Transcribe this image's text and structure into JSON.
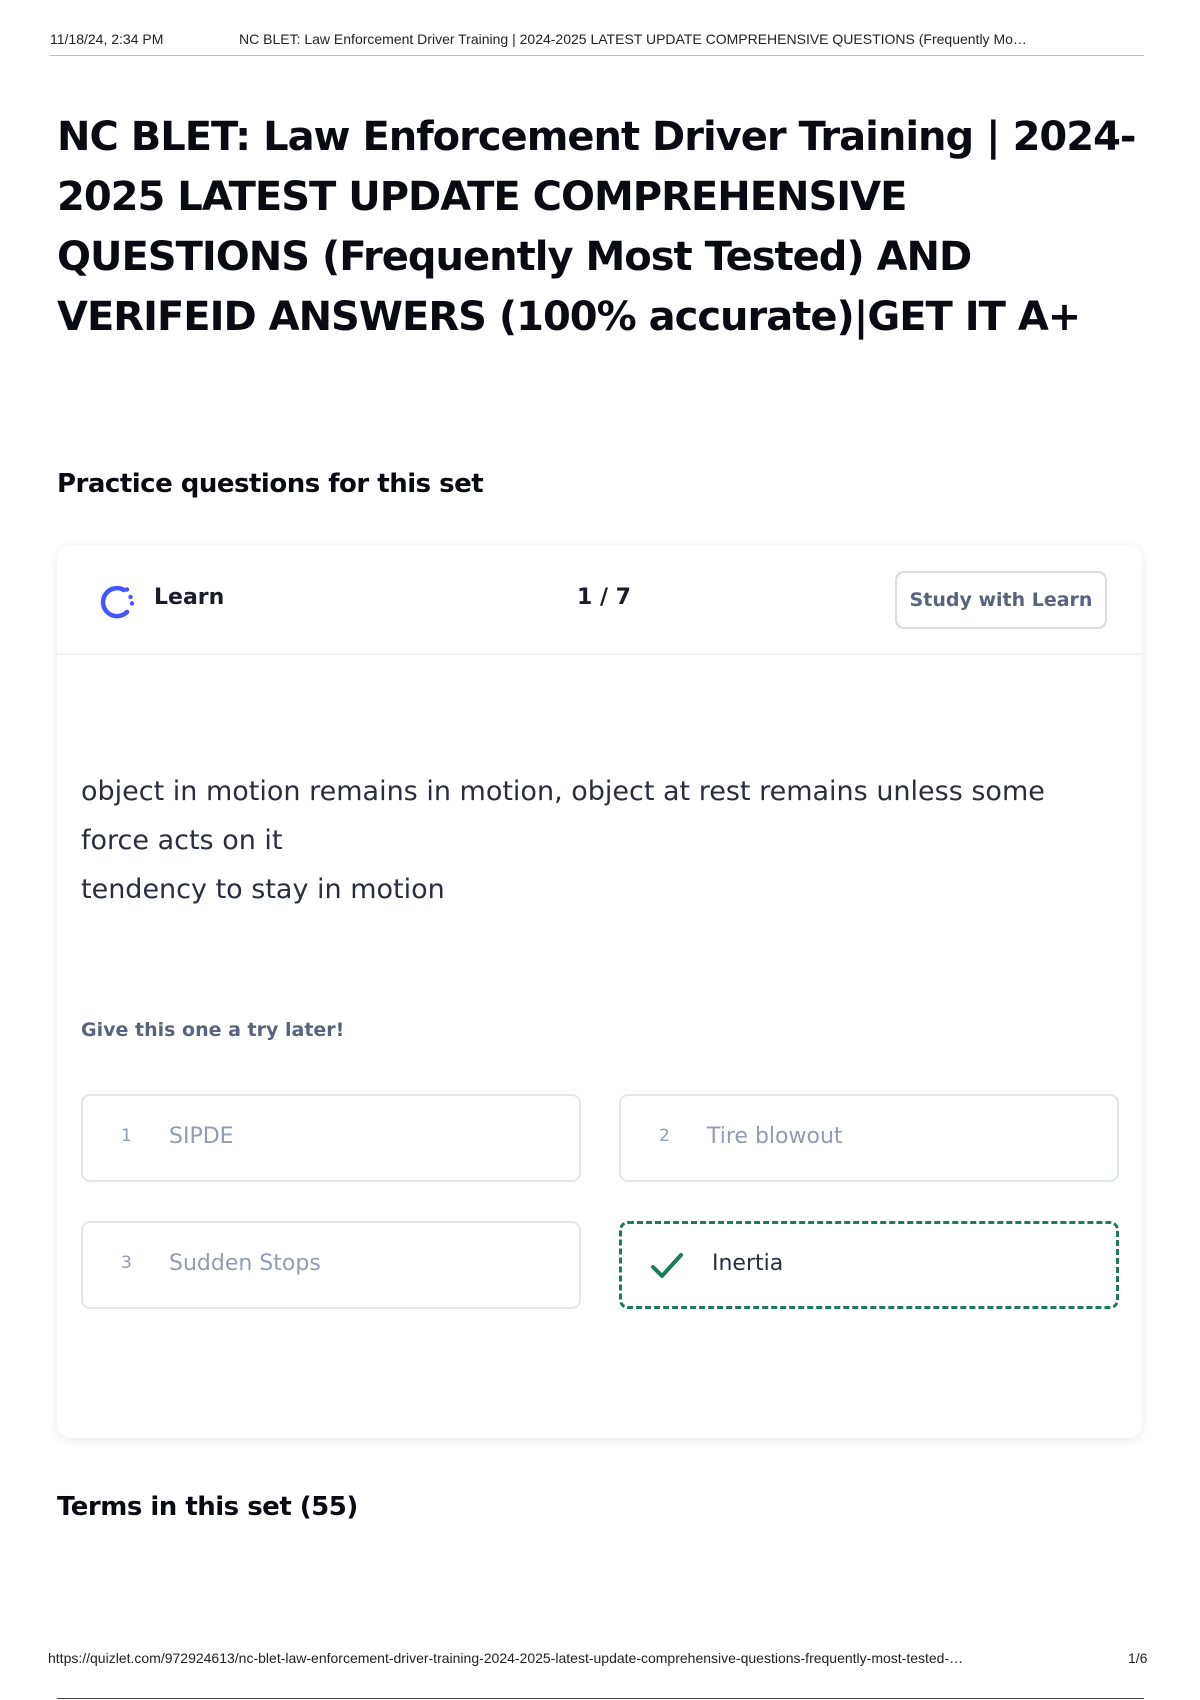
{
  "print_header": {
    "date": "11/18/24, 2:34 PM",
    "title": "NC BLET: Law Enforcement Driver Training | 2024-2025 LATEST UPDATE COMPREHENSIVE QUESTIONS (Frequently Mo…"
  },
  "document": {
    "title": "NC BLET: Law Enforcement Driver Training | 2024-2025 LATEST UPDATE COMPREHENSIVE QUESTIONS (Frequently Most Tested) AND VERIFEID ANSWERS (100% accurate)|GET IT A+"
  },
  "practice": {
    "heading": "Practice questions for this set",
    "card": {
      "mode_icon": "learn-spinner-icon",
      "mode_label": "Learn",
      "progress": "1 / 7",
      "study_button_label": "Study with Learn",
      "question_lines": [
        "object in motion remains in motion, object at rest remains unless some",
        "force acts on it",
        "tendency to stay in motion"
      ],
      "hint": "Give this one a try later!",
      "options": [
        {
          "number": "1",
          "label": "SIPDE",
          "state": "dimmed"
        },
        {
          "number": "2",
          "label": "Tire blowout",
          "state": "dimmed"
        },
        {
          "number": "3",
          "label": "Sudden Stops",
          "state": "dimmed"
        },
        {
          "number": "",
          "label": "Inertia",
          "state": "correct",
          "icon": "checkmark-icon"
        }
      ],
      "accent_color": "#4255ff",
      "correct_color": "#1d7a5c"
    }
  },
  "terms": {
    "heading": "Terms in this set (55)"
  },
  "print_footer": {
    "url": "https://quizlet.com/972924613/nc-blet-law-enforcement-driver-training-2024-2025-latest-update-comprehensive-questions-frequently-most-tested-…",
    "page": "1/6"
  }
}
